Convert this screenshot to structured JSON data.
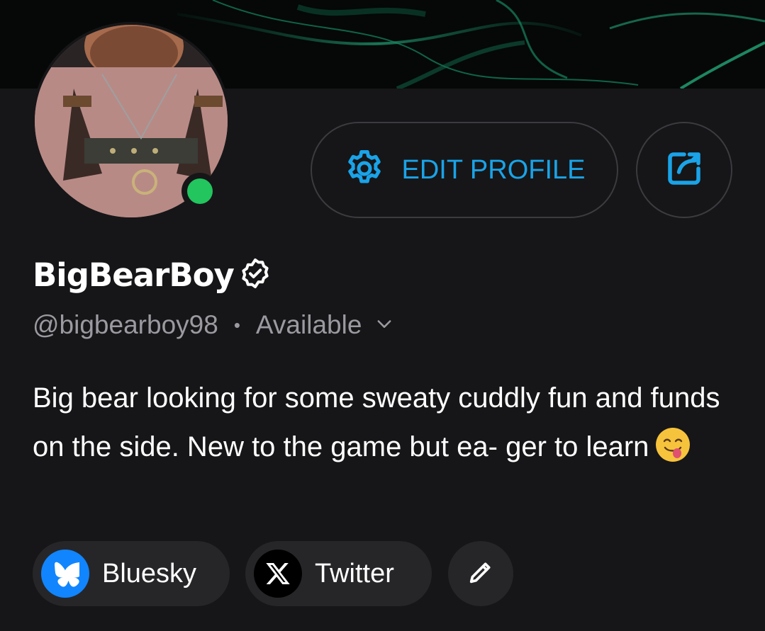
{
  "profile": {
    "display_name": "BigBearBoy",
    "handle": "@bigbearboy98",
    "separator": "•",
    "status": "Available",
    "bio": "Big bear looking for some sweaty cuddly fun and funds on the side. New to the game but ea- ger to learn",
    "bio_emoji": "face-savoring-food-emoji",
    "presence": "online",
    "verified": true
  },
  "actions": {
    "edit_profile_label": "EDIT PROFILE",
    "edit_profile_icon": "gear-icon",
    "share_icon": "share-icon"
  },
  "links": [
    {
      "label": "Bluesky",
      "icon": "bluesky-butterfly-icon"
    },
    {
      "label": "Twitter",
      "icon": "x-logo-icon"
    }
  ],
  "edit_links_icon": "pencil-icon",
  "colors": {
    "background": "#161618",
    "accent": "#1aa3e8",
    "presence_online": "#22c55e",
    "muted_text": "#9a9aa0",
    "chip_background": "#262629",
    "bluesky_blue": "#1185fe"
  }
}
